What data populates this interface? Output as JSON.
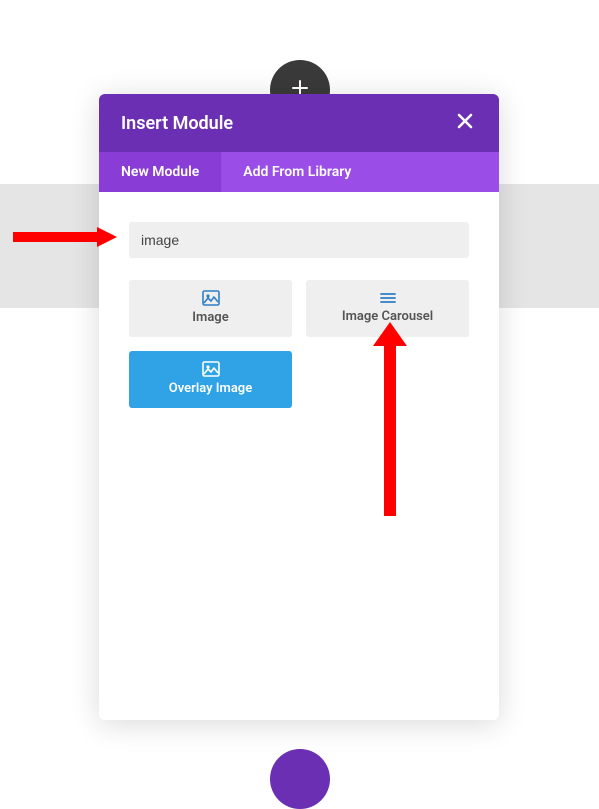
{
  "modal": {
    "title": "Insert Module",
    "tabs": {
      "new_module": "New Module",
      "add_from_library": "Add From Library"
    },
    "search_value": "image",
    "modules": {
      "image": "Image",
      "image_carousel": "Image Carousel",
      "overlay_image": "Overlay Image"
    }
  },
  "colors": {
    "header_purple": "#6B2FB3",
    "tab_purple": "#9B4DE8",
    "tab_active_purple": "#8A3DD6",
    "blue_card": "#2FA3E6",
    "arrow_red": "#FF0000"
  }
}
